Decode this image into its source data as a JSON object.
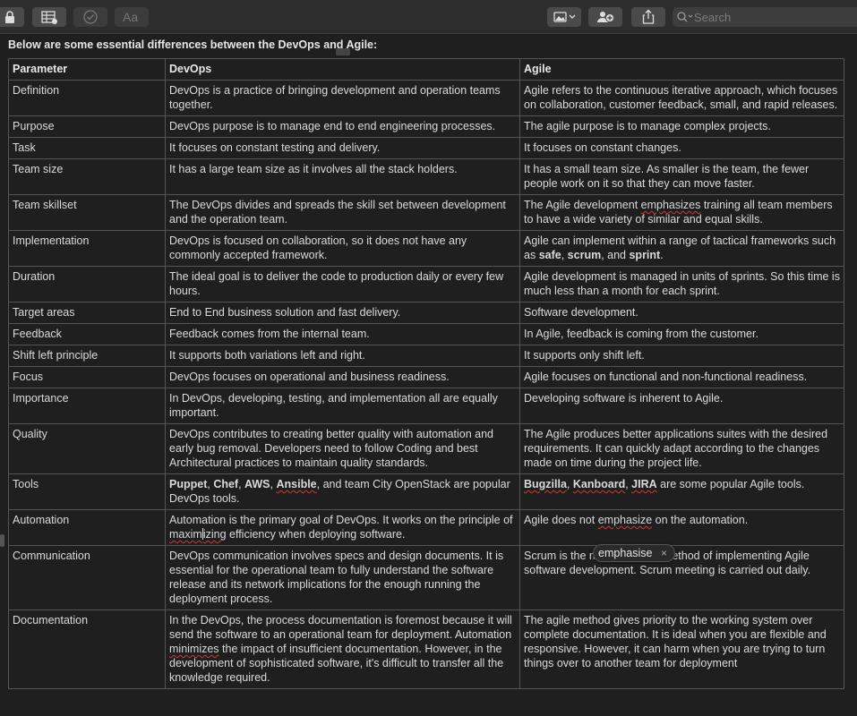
{
  "search": {
    "placeholder": "Search"
  },
  "intro": "Below are some essential differences between the DevOps and Agile:",
  "table": {
    "headers": [
      "Parameter",
      "DevOps",
      "Agile"
    ],
    "rows": [
      [
        "Definition",
        "DevOps is a practice of bringing development and operation teams together.",
        "Agile refers to the continuous iterative approach, which focuses on collaboration, customer feedback, small, and rapid releases."
      ],
      [
        "Purpose",
        "DevOps purpose is to manage end to end engineering processes.",
        "The agile purpose is to manage complex projects."
      ],
      [
        "Task",
        "It focuses on constant testing and delivery.",
        "It focuses on constant changes."
      ],
      [
        "Team size",
        "It has a large team size as it involves all the stack holders.",
        "It has a small team size. As smaller is the team, the fewer people work on it so that they can move faster."
      ],
      [
        "Team skillset",
        "The DevOps divides and spreads the skill set between development and the operation team.",
        "The Agile development emphasizes training all team members to have a wide variety of similar and equal skills."
      ],
      [
        "Implementation",
        "DevOps is focused on collaboration, so it does not have any commonly accepted framework.",
        "Agile can implement within a range of tactical frameworks such as safe, scrum, and sprint."
      ],
      [
        "Duration",
        "The ideal goal is to deliver the code to production daily or every few hours.",
        "Agile development is managed in units of sprints. So this time is much less than a month for each sprint."
      ],
      [
        "Target areas",
        "End to End business solution and fast delivery.",
        "Software development."
      ],
      [
        "Feedback",
        "Feedback comes from the internal team.",
        "In Agile, feedback is coming from the customer."
      ],
      [
        "Shift left principle",
        "It supports both variations left and right.",
        "It supports only shift left."
      ],
      [
        "Focus",
        "DevOps focuses on operational and business readiness.",
        "Agile focuses on functional and non-functional readiness."
      ],
      [
        "Importance",
        "In DevOps, developing, testing, and implementation all are equally important.",
        "Developing software is inherent to Agile."
      ],
      [
        "Quality",
        "DevOps contributes to creating better quality with automation and early bug removal. Developers need to follow Coding and best Architectural practices to maintain quality standards.",
        "The Agile produces better applications suites with the desired requirements. It can quickly adapt according to the changes made on time during the project life."
      ],
      [
        "Tools",
        "Puppet, Chef, AWS, Ansible, and team City OpenStack are popular DevOps tools.",
        "Bugzilla, Kanboard, JIRA are some popular Agile tools."
      ],
      [
        "Automation",
        "Automation is the primary goal of DevOps. It works on the principle of maximizing efficiency when deploying software.",
        "Agile does not emphasize on the automation."
      ],
      [
        "Communication",
        "DevOps communication involves specs and design documents. It is essential for the operational team to fully understand the software release and its network implications for the enough running the deployment process.",
        "Scrum is the most common method of implementing Agile software development. Scrum meeting is carried out daily."
      ],
      [
        "Documentation",
        "In the DevOps, the process documentation is foremost because it will send the software to an operational team for deployment. Automation minimizes the impact of insufficient documentation. However, in the development of sophisticated software, it's difficult to transfer all the knowledge required.",
        "The agile method gives priority to the working system over complete documentation. It is ideal when you are flexible and responsive. However, it can harm when you are trying to turn things over to another team for deployment"
      ]
    ]
  },
  "spell_suggestion": {
    "word": "emphasise",
    "close": "×"
  }
}
